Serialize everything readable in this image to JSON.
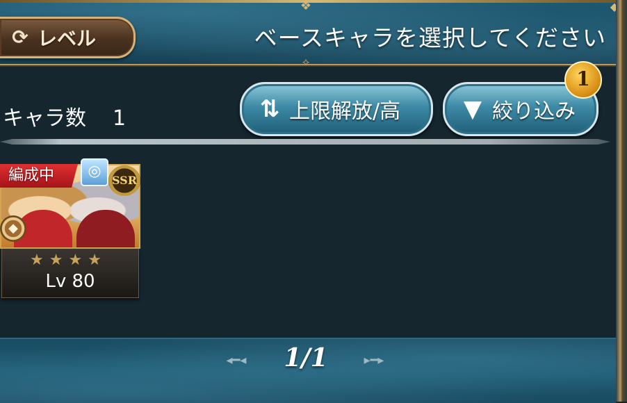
{
  "header": {
    "level_button_label": "レベル",
    "level_button_icon": "refresh-icon",
    "title": "ベースキャラを選択してください"
  },
  "toolbar": {
    "char_count_label": "キャラ数",
    "char_count_value": "1",
    "sort_button_label": "上限解放/高",
    "sort_button_icon": "sort-arrows-icon",
    "filter_button_label": "絞り込み",
    "filter_button_icon": "funnel-icon",
    "filter_badge_count": "1"
  },
  "characters": [
    {
      "status": "編成中",
      "rarity": "SSR",
      "stars": 4,
      "level": "Lv 80",
      "element_icon": "earth-element-icon",
      "ring_icon": "ring-icon"
    }
  ],
  "pager": {
    "indicator": "1/1"
  },
  "colors": {
    "panel_bg": "#15262f",
    "header_bg": "#1d5a72",
    "gold_trim": "#d8b873",
    "status_red": "#d42a2a",
    "badge_gold": "#e8a020"
  }
}
